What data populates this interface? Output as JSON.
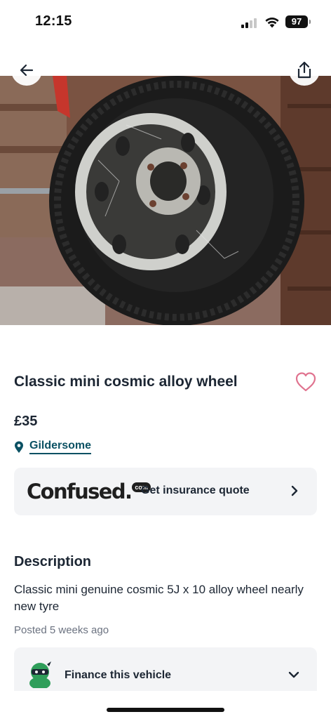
{
  "status_bar": {
    "time": "12:15",
    "battery": "97"
  },
  "listing": {
    "title": "Classic mini cosmic alloy wheel",
    "price": "£35",
    "location": "Gildersome"
  },
  "insurance": {
    "brand_word": "Confused.",
    "brand_suffix": "com",
    "label": "Get insurance quote"
  },
  "description": {
    "heading": "Description",
    "body": "Classic mini genuine cosmic 5J x 10 alloy wheel nearly new tyre",
    "posted": "Posted 5 weeks ago"
  },
  "finance": {
    "label": "Finance this vehicle"
  },
  "icons": {
    "back": "arrow-left-icon",
    "share": "share-icon",
    "favorite": "heart-icon",
    "location": "map-pin-icon",
    "chevron_right": "chevron-right-icon",
    "chevron_down": "chevron-down-icon"
  },
  "colors": {
    "accent_link": "#0b5163",
    "heart": "#e0738f",
    "card_bg": "#f3f4f6",
    "text_primary": "#1c2633",
    "text_secondary": "#6b7280"
  }
}
